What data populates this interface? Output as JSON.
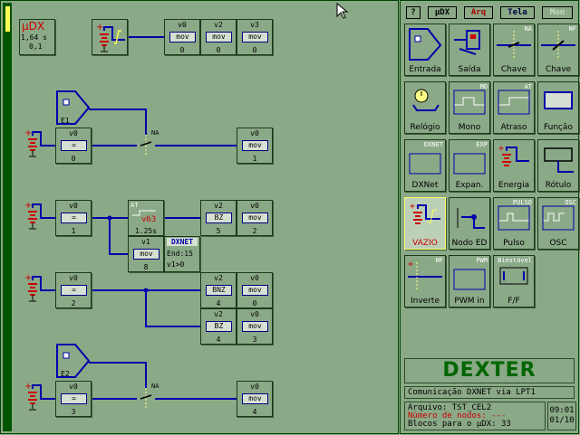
{
  "controller": {
    "name": "µDX",
    "cycle": "1,64 s",
    "version": "0,1"
  },
  "toolbar": {
    "help_label": "?",
    "udx_label": "µDX",
    "arq_label": "Arq",
    "tela_label": "Tela",
    "mon_label": "Mon"
  },
  "palette": [
    {
      "label": "Entrada",
      "icon": "entrada-icon"
    },
    {
      "label": "Saída",
      "icon": "saida-icon"
    },
    {
      "label": "Chave",
      "icon": "chave-na-icon",
      "tag": "NA"
    },
    {
      "label": "Chave",
      "icon": "chave-nf-icon",
      "tag": "NF"
    },
    {
      "label": "Relógio",
      "icon": "relogio-icon"
    },
    {
      "label": "Mono",
      "icon": "mono-icon",
      "tag": "MO"
    },
    {
      "label": "Atraso",
      "icon": "atraso-icon",
      "tag": "AT"
    },
    {
      "label": "Função",
      "icon": "funcao-icon"
    },
    {
      "label": "DXNet",
      "icon": "dxnet-icon",
      "tag": "DXNET"
    },
    {
      "label": "Expan.",
      "icon": "expansao-icon",
      "tag": "EXP"
    },
    {
      "label": "Energia",
      "icon": "energia-icon"
    },
    {
      "label": "Rótulo",
      "icon": "rotulo-icon"
    },
    {
      "label": "VAZIO",
      "icon": "vazio-icon",
      "selected": true
    },
    {
      "label": "Nodo ED",
      "icon": "nodo-ed-icon"
    },
    {
      "label": "Pulso",
      "icon": "pulso-icon",
      "tag": "PULSO"
    },
    {
      "label": "OSC",
      "icon": "osc-icon",
      "tag": "OSC"
    },
    {
      "label": "Inverte",
      "icon": "inverte-icon",
      "tag": "NF"
    },
    {
      "label": "PWM in",
      "icon": "pwm-icon",
      "tag": "PWM"
    },
    {
      "label": "F/F",
      "icon": "flipflop-icon",
      "tag": "Biestável"
    }
  ],
  "blocks": {
    "top_v0": {
      "head": "v0",
      "op": "mov",
      "foot": "0"
    },
    "top_v2": {
      "head": "v2",
      "op": "mov",
      "foot": "0"
    },
    "top_v3": {
      "head": "v3",
      "op": "mov",
      "foot": "0"
    },
    "e1_label": "E1",
    "r1_in": {
      "head": "v0",
      "op": "=",
      "foot": "0"
    },
    "r1_sw": "NA",
    "r1_out": {
      "head": "v0",
      "op": "mov",
      "foot": "1"
    },
    "r2_in": {
      "head": "v0",
      "op": "=",
      "foot": "1"
    },
    "r2_at": {
      "tag": "AT",
      "var": "v63",
      "time": "1.25s"
    },
    "r2_bz": {
      "head": "v2",
      "op": "BZ",
      "foot": "5"
    },
    "r2_out": {
      "head": "v0",
      "op": "mov",
      "foot": "2"
    },
    "r2_mov": {
      "head": "v1",
      "op": "mov",
      "foot": "8"
    },
    "dxnet": {
      "title": "DXNET",
      "line1": "End:15",
      "line2": "v1>0"
    },
    "r3_in": {
      "head": "v0",
      "op": "=",
      "foot": "2"
    },
    "r3_bnz": {
      "head": "v2",
      "op": "BNZ",
      "foot": "4"
    },
    "r3_out": {
      "head": "v0",
      "op": "mov",
      "foot": "0"
    },
    "r4_bz": {
      "head": "v2",
      "op": "BZ",
      "foot": "4"
    },
    "r4_out": {
      "head": "v0",
      "op": "mov",
      "foot": "3"
    },
    "e2_label": "E2",
    "r5_in": {
      "head": "v0",
      "op": "=",
      "foot": "3"
    },
    "r5_sw": "NA",
    "r5_out": {
      "head": "v0",
      "op": "mov",
      "foot": "4"
    }
  },
  "brand": "DEXTER",
  "status": {
    "comm": "Comunicação DXNET via LPT1",
    "file_label": "Arquivo: TST_CEL2",
    "nodes_label": "Número de nodos: ---",
    "blocks_label": "Blocos para o µDX: 33",
    "time": "09:01",
    "date": "01/10"
  },
  "colors": {
    "background": "#8aa987",
    "wire": "#0000aa",
    "accent": "#cc0000",
    "brand": "#006600"
  }
}
